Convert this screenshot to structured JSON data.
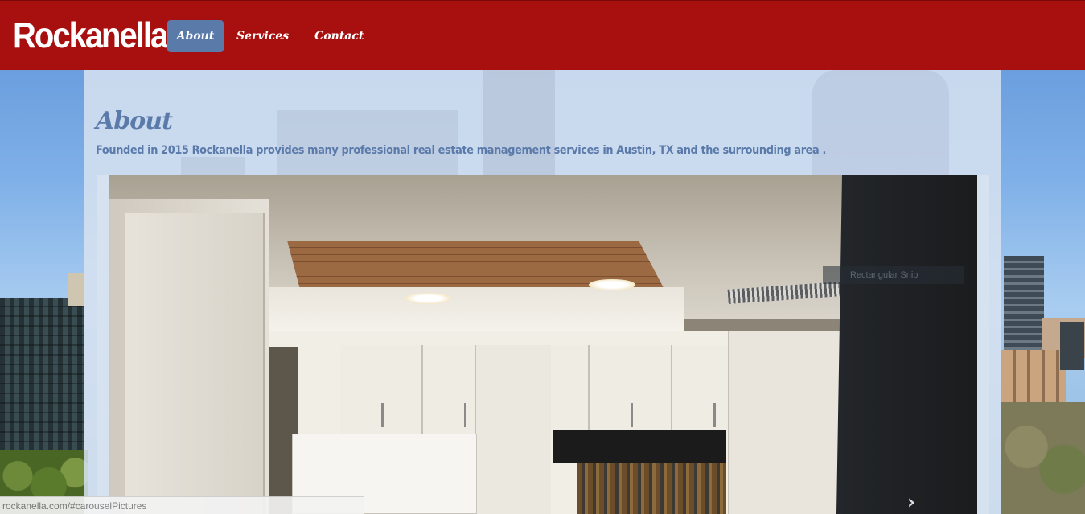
{
  "brand": "Rockanella",
  "nav": {
    "items": [
      {
        "label": "About",
        "active": true
      },
      {
        "label": "Services",
        "active": false
      },
      {
        "label": "Contact",
        "active": false
      }
    ]
  },
  "about": {
    "title": "About",
    "text": "Founded in 2015 Rockanella provides many professional real estate management services in Austin, TX and the surrounding area ."
  },
  "carousel": {
    "overlay_text": "Rectangular Snip",
    "prev_icon": "chevron-left-icon",
    "next_icon": "chevron-right-icon"
  },
  "status_bar": {
    "url": "rockanella.com/#carouselPictures"
  },
  "colors": {
    "navbar": "#a81010",
    "accent": "#5a7aaa",
    "panel": "#d7e2f0"
  }
}
